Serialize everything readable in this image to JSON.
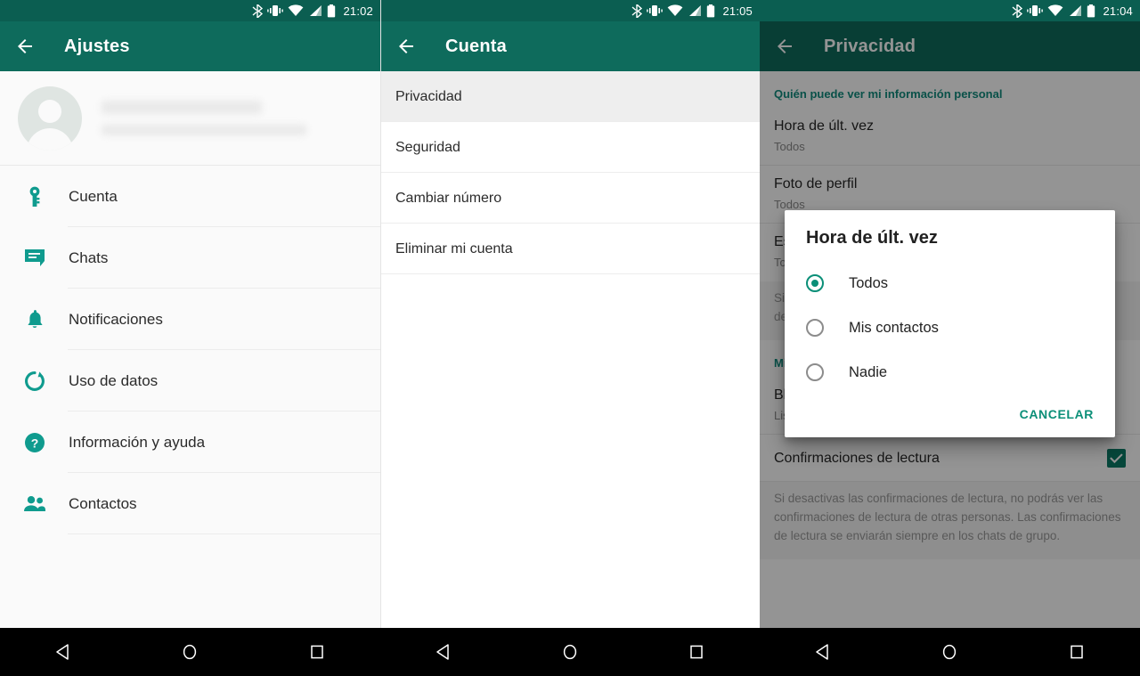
{
  "phones": {
    "left": {
      "status": {
        "time": "21:02",
        "icons": [
          "bluetooth-icon",
          "vibrate-icon",
          "wifi-icon",
          "signal-icon",
          "battery-icon"
        ]
      },
      "appbar": {
        "title": "Ajustes",
        "back": "back-arrow-icon"
      },
      "profile": {
        "name_redacted": "",
        "status_redacted": ""
      },
      "nav_items": [
        {
          "label": "Cuenta",
          "icon": "key-icon"
        },
        {
          "label": "Chats",
          "icon": "chat-bubble-icon"
        },
        {
          "label": "Notificaciones",
          "icon": "bell-icon"
        },
        {
          "label": "Uso de datos",
          "icon": "data-usage-icon"
        },
        {
          "label": "Información y ayuda",
          "icon": "help-circle-icon"
        },
        {
          "label": "Contactos",
          "icon": "contacts-icon"
        }
      ]
    },
    "middle": {
      "status": {
        "time": "21:05"
      },
      "appbar": {
        "title": "Cuenta",
        "back": "back-arrow-icon"
      },
      "rows": [
        {
          "label": "Privacidad",
          "selected": true
        },
        {
          "label": "Seguridad",
          "selected": false
        },
        {
          "label": "Cambiar número",
          "selected": false
        },
        {
          "label": "Eliminar mi cuenta",
          "selected": false
        }
      ]
    },
    "right": {
      "status": {
        "time": "21:04"
      },
      "appbar": {
        "title": "Privacidad",
        "back": "back-arrow-icon"
      },
      "section_header": "Quién puede ver mi información personal",
      "privacy_rows": [
        {
          "title": "Hora de últ. vez",
          "sub": "Todos"
        },
        {
          "title": "Foto de perfil",
          "sub": "Todos"
        },
        {
          "title": "Estado",
          "sub": "Todos"
        }
      ],
      "status_note": "Si compartes tu última hora de conexión, también verás la hora de última conexión de los demás.",
      "contacts_section_header": "Mis contactos",
      "blocked_row": {
        "title": "Bloqueados",
        "sub": "Lista de los contactos bloqueados."
      },
      "read_receipts": {
        "label": "Confirmaciones de lectura",
        "checked": true,
        "icon": "check-icon"
      },
      "read_receipts_note": "Si desactivas las confirmaciones de lectura, no podrás ver las confirmaciones de lectura de otras personas. Las confirmaciones de lectura se enviarán siempre en los chats de grupo."
    }
  },
  "dialog": {
    "title": "Hora de últ. vez",
    "options": [
      {
        "label": "Todos",
        "checked": true
      },
      {
        "label": "Mis contactos",
        "checked": false
      },
      {
        "label": "Nadie",
        "checked": false
      }
    ],
    "cancel_label": "CANCELAR"
  },
  "navbar": {
    "buttons": [
      {
        "name": "back-button",
        "icon": "triangle-left-icon"
      },
      {
        "name": "home-button",
        "icon": "circle-icon"
      },
      {
        "name": "recents-button",
        "icon": "square-icon"
      }
    ]
  },
  "colors": {
    "statusbar": "#0b5e51",
    "appbar": "#0e6b5c",
    "accent_teal": "#0f9b8e",
    "section_header": "#128c7e",
    "dialog_accent": "#0b8f78"
  }
}
